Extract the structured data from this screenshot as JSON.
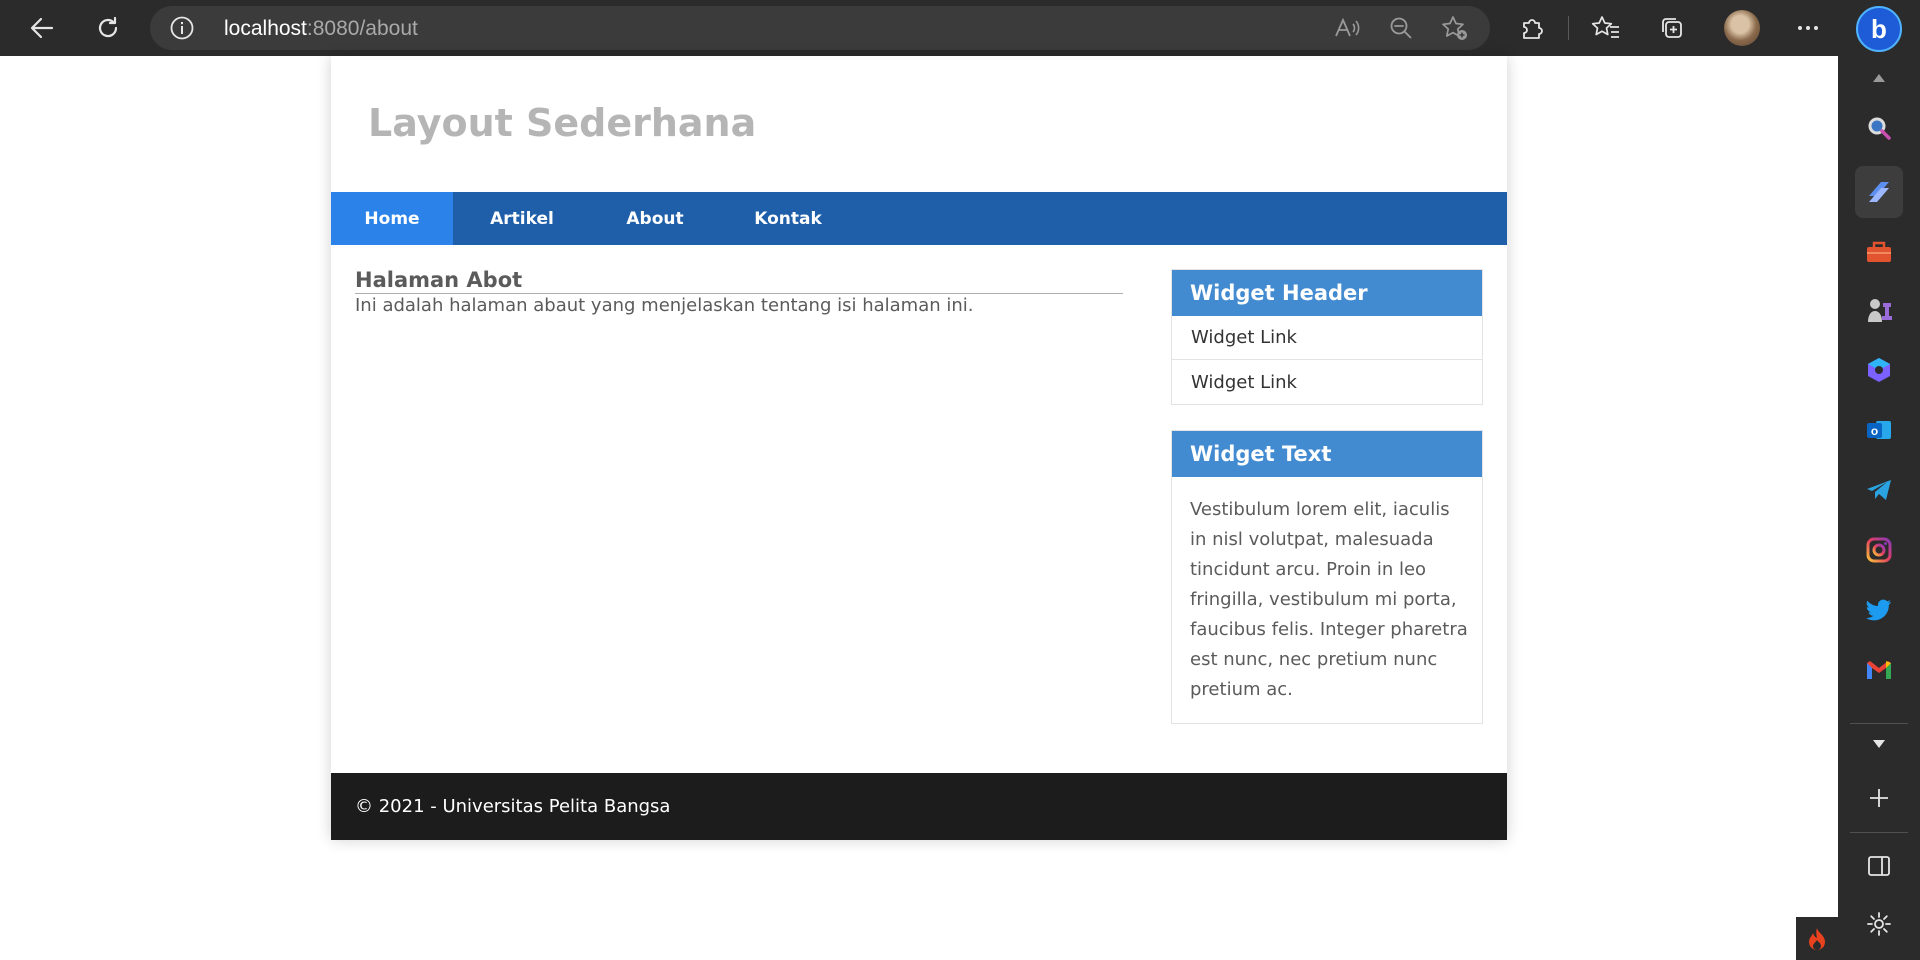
{
  "browser": {
    "url_host": "localhost",
    "url_rest": ":8080/about",
    "accent": "#1e5bd6",
    "icons": [
      "back-icon",
      "refresh-icon",
      "site-info-icon",
      "read-aloud-icon",
      "zoom-out-icon",
      "add-favorite-icon",
      "extensions-icon",
      "favorites-icon",
      "collections-icon",
      "profile-avatar",
      "more-icon",
      "bing-chat-icon"
    ]
  },
  "sidebar": {
    "icons": [
      "scroll-up-icon",
      "search-icon",
      "copilot-icon",
      "tools-icon",
      "games-icon",
      "microsoft365-icon",
      "outlook-icon",
      "telegram-icon",
      "instagram-icon",
      "twitter-icon",
      "gmail-icon",
      "scroll-down-icon",
      "add-icon",
      "split-view-icon",
      "settings-icon"
    ]
  },
  "site": {
    "title": "Layout Sederhana",
    "nav": [
      {
        "label": "Home",
        "active": true
      },
      {
        "label": "Artikel",
        "active": false
      },
      {
        "label": "About",
        "active": false
      },
      {
        "label": "Kontak",
        "active": false
      }
    ],
    "content": {
      "heading": "Halaman Abot",
      "body": "Ini adalah halaman abaut yang menjelaskan tentang isi halaman ini."
    },
    "widgets": {
      "header": {
        "title": "Widget Header",
        "links": [
          "Widget Link",
          "Widget Link"
        ]
      },
      "text": {
        "title": "Widget Text",
        "body": "Vestibulum lorem elit, iaculis in nisl volutpat, malesuada tincidunt arcu. Proin in leo fringilla, vestibulum mi porta, faucibus felis. Integer pharetra est nunc, nec pretium nunc pretium ac."
      }
    },
    "footer": "© 2021 - Universitas Pelita Bangsa",
    "colors": {
      "nav_bg": "#1f5faa",
      "nav_active": "#2b83ea",
      "widget_header": "#428bd1",
      "footer_bg": "#1c1c1c",
      "title_color": "#b5b5b5"
    }
  }
}
